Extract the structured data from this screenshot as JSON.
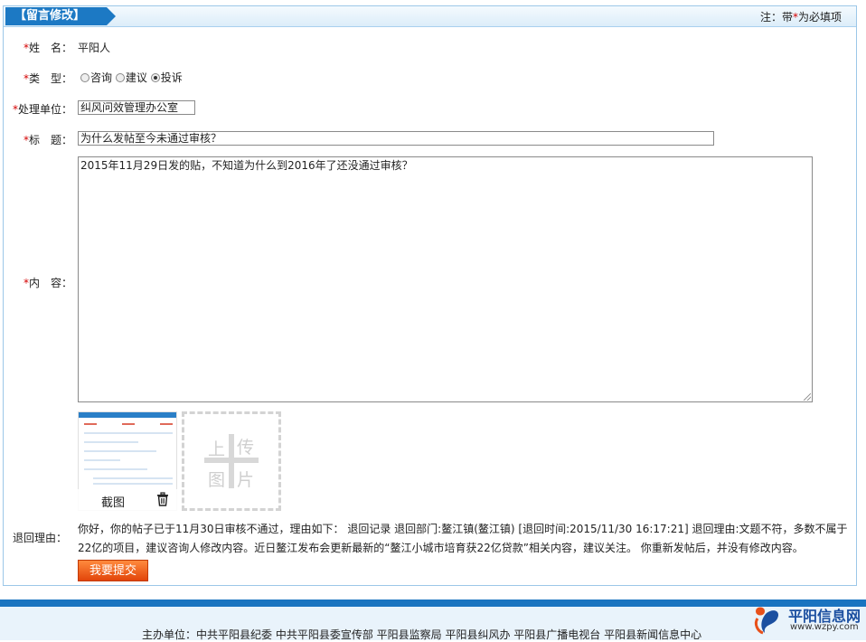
{
  "header": {
    "tab_title": "【留言修改】",
    "note_prefix": "注：带",
    "note_star": "*",
    "note_suffix": "为必填项"
  },
  "form": {
    "name_label": "姓　名：",
    "name_value": "平阳人",
    "type_label": "类　型：",
    "type_options": [
      "咨询",
      "建议",
      "投诉"
    ],
    "type_selected": "投诉",
    "unit_label": "处理单位：",
    "unit_value": "纠风问效管理办公室",
    "title_label": "标　题：",
    "title_value": "为什么发帖至今未通过审核？",
    "content_label": "内　容：",
    "content_value": "2015年11月29日发的贴，不知道为什么到2016年了还没通过审核？",
    "screenshot_caption": "截图",
    "upload_chars": [
      "上",
      "传",
      "图",
      "片"
    ],
    "reason_label": "退回理由：",
    "reason_text": "你好，你的帖子已于11月30日审核不通过，理由如下： 退回记录 退回部门:鳌江镇(鳌江镇) [退回时间:2015/11/30 16:17:21] 退回理由:文题不符，多数不属于22亿的项目，建议咨询人修改内容。近日鳌江发布会更新最新的“鳌江小城市培育获22亿贷款”相关内容，建议关注。 你重新发帖后，并没有修改内容。",
    "submit_label": "我要提交",
    "required_mark": "*"
  },
  "footer": {
    "sponsors": "主办单位：中共平阳县纪委  中共平阳县委宣传部  平阳县监察局  平阳县纠风办  平阳县广播电视台  平阳县新闻信息中心",
    "logo_name": "平阳信息网",
    "logo_url": "www.wzpy.com"
  },
  "colors": {
    "accent": "#1c79c4",
    "required": "#d40000",
    "submit": "#e2450a"
  }
}
